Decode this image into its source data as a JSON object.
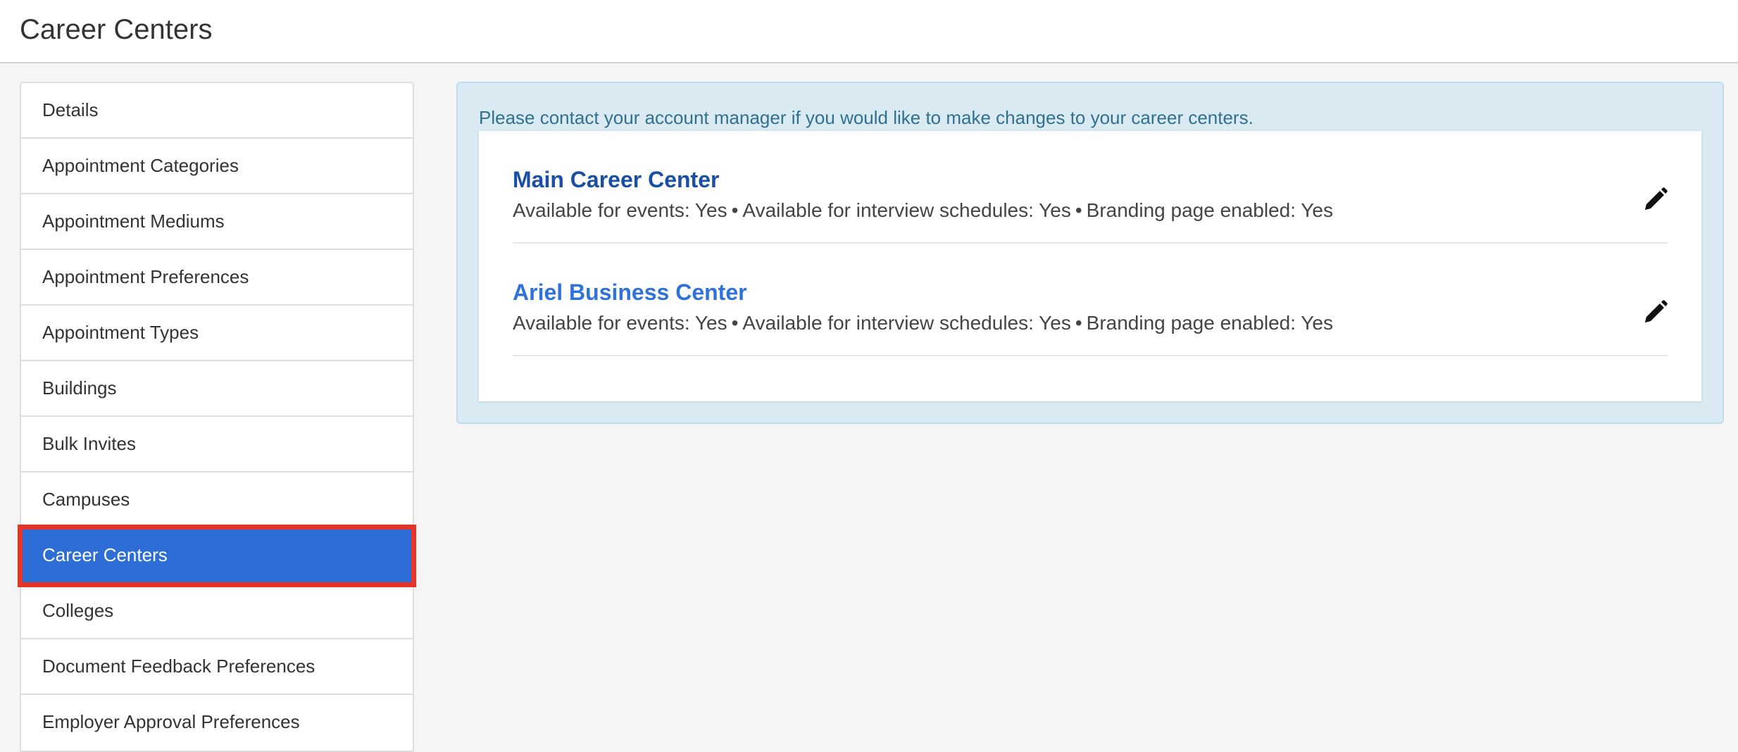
{
  "header": {
    "title": "Career Centers"
  },
  "sidebar": {
    "items": [
      {
        "label": "Details"
      },
      {
        "label": "Appointment Categories"
      },
      {
        "label": "Appointment Mediums"
      },
      {
        "label": "Appointment Preferences"
      },
      {
        "label": "Appointment Types"
      },
      {
        "label": "Buildings"
      },
      {
        "label": "Bulk Invites"
      },
      {
        "label": "Campuses"
      },
      {
        "label": "Career Centers",
        "active": true
      },
      {
        "label": "Colleges"
      },
      {
        "label": "Document Feedback Preferences"
      },
      {
        "label": "Employer Approval Preferences"
      }
    ]
  },
  "main": {
    "notice": "Please contact your account manager if you would like to make changes to your career centers.",
    "centers": [
      {
        "name": "Main Career Center",
        "events": "Available for events: Yes",
        "interviews": "Available for interview schedules: Yes",
        "branding": "Branding page enabled: Yes",
        "edit_icon": "pencil-icon"
      },
      {
        "name": "Ariel Business Center",
        "events": "Available for events: Yes",
        "interviews": "Available for interview schedules: Yes",
        "branding": "Branding page enabled: Yes",
        "edit_icon": "pencil-icon"
      }
    ],
    "separator": "•"
  },
  "colors": {
    "accent": "#2d6ed6",
    "highlight_outline": "#e63324",
    "notice_bg": "#d9eaf3",
    "notice_text": "#31708f",
    "link_dark": "#1a4fa3",
    "link_light": "#2f73d8"
  }
}
